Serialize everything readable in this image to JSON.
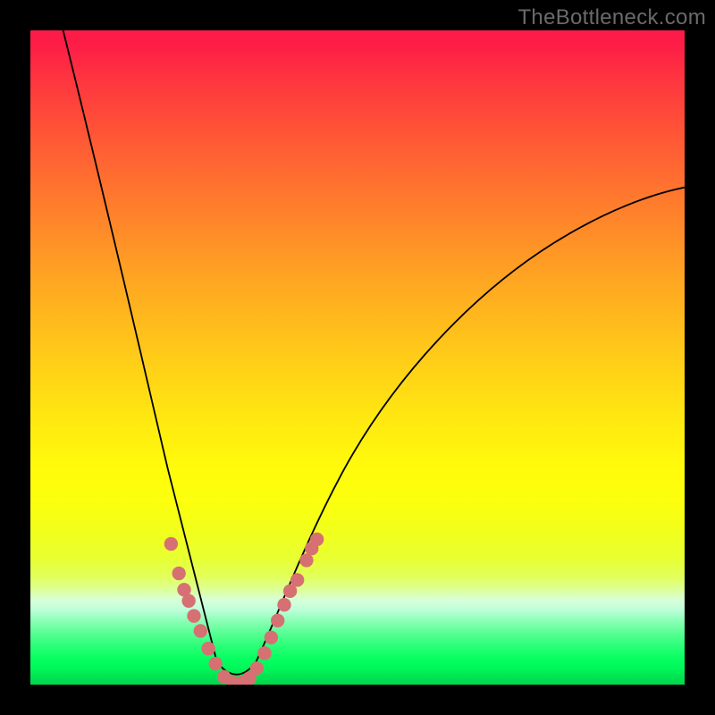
{
  "watermark": "TheBottleneck.com",
  "colors": {
    "frame": "#000000",
    "curve_stroke": "#000000",
    "marker_fill": "#d67072",
    "gradient_top": "#fd1c47",
    "gradient_bottom": "#00d74c"
  },
  "chart_data": {
    "type": "line",
    "title": "",
    "xlabel": "",
    "ylabel": "",
    "xlim": [
      0,
      100
    ],
    "ylim": [
      0,
      100
    ],
    "note": "No axis ticks or numeric labels are shown in image; values below are normalized estimates (0-100) read from pixel positions.",
    "series": [
      {
        "name": "left-branch",
        "x": [
          5.0,
          10.0,
          14.0,
          17.0,
          19.5,
          21.0,
          22.5,
          24.0,
          25.5,
          27.0,
          28.5
        ],
        "y": [
          100.0,
          69.5,
          50.0,
          37.0,
          28.5,
          23.0,
          18.0,
          13.5,
          9.5,
          5.5,
          2.0
        ]
      },
      {
        "name": "valley",
        "x": [
          28.5,
          30.0,
          31.5,
          33.0,
          34.5
        ],
        "y": [
          2.0,
          0.4,
          0.0,
          0.4,
          2.0
        ]
      },
      {
        "name": "right-branch",
        "x": [
          34.5,
          37.0,
          40.0,
          44.0,
          50.0,
          58.0,
          68.0,
          80.0,
          92.0,
          100.0
        ],
        "y": [
          2.0,
          7.5,
          14.0,
          22.0,
          32.5,
          44.0,
          55.5,
          65.5,
          72.5,
          76.0
        ]
      }
    ],
    "markers": {
      "name": "salmon-beads",
      "points": [
        {
          "x": 21.5,
          "y": 21.5
        },
        {
          "x": 22.7,
          "y": 17.0
        },
        {
          "x": 23.5,
          "y": 14.5
        },
        {
          "x": 24.2,
          "y": 12.8
        },
        {
          "x": 25.0,
          "y": 10.5
        },
        {
          "x": 26.0,
          "y": 8.2
        },
        {
          "x": 27.2,
          "y": 5.5
        },
        {
          "x": 28.3,
          "y": 3.2
        },
        {
          "x": 29.6,
          "y": 1.2
        },
        {
          "x": 31.0,
          "y": 0.3
        },
        {
          "x": 32.3,
          "y": 0.3
        },
        {
          "x": 33.5,
          "y": 1.0
        },
        {
          "x": 34.6,
          "y": 2.5
        },
        {
          "x": 35.8,
          "y": 4.8
        },
        {
          "x": 36.8,
          "y": 7.2
        },
        {
          "x": 37.8,
          "y": 9.8
        },
        {
          "x": 38.8,
          "y": 12.2
        },
        {
          "x": 39.7,
          "y": 14.3
        },
        {
          "x": 40.8,
          "y": 16.0
        },
        {
          "x": 42.2,
          "y": 19.0
        },
        {
          "x": 43.0,
          "y": 20.8
        },
        {
          "x": 43.8,
          "y": 22.2
        }
      ]
    }
  }
}
